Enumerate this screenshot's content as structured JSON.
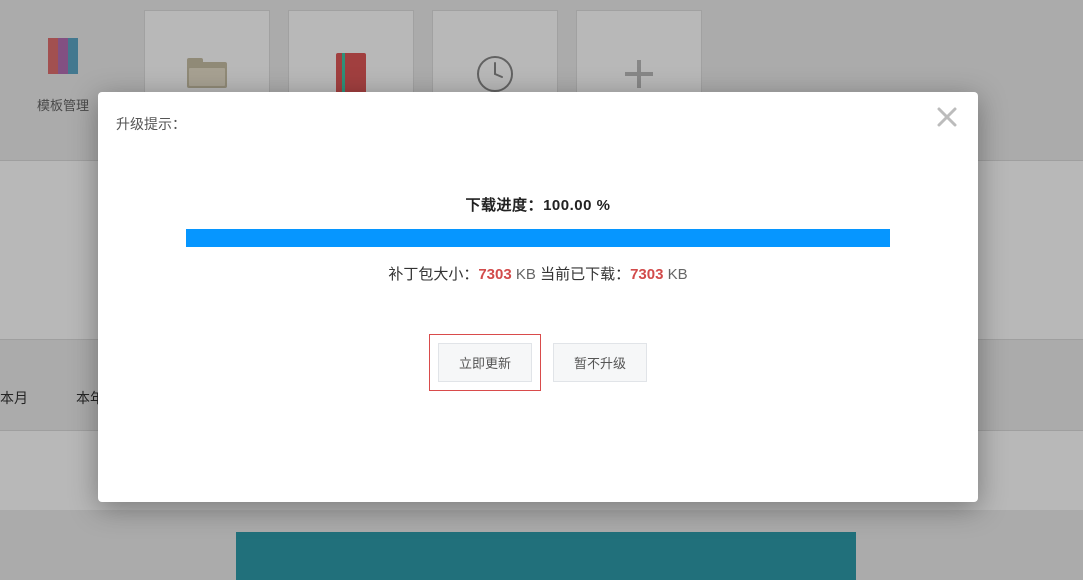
{
  "tiles": {
    "template_mgmt": "模板管理"
  },
  "tabs": {
    "this_month": "本月",
    "this_year": "本年度"
  },
  "modal": {
    "title": "升级提示：",
    "progress_prefix": "下载进度：",
    "progress_value": "100.00 %",
    "patch_size_label": "补丁包大小：",
    "patch_size_value": "7303",
    "patch_size_unit": " KB ",
    "downloaded_label": "当前已下载：",
    "downloaded_value": "7303",
    "downloaded_unit": " KB",
    "update_now": "立即更新",
    "skip_upgrade": "暂不升级"
  }
}
